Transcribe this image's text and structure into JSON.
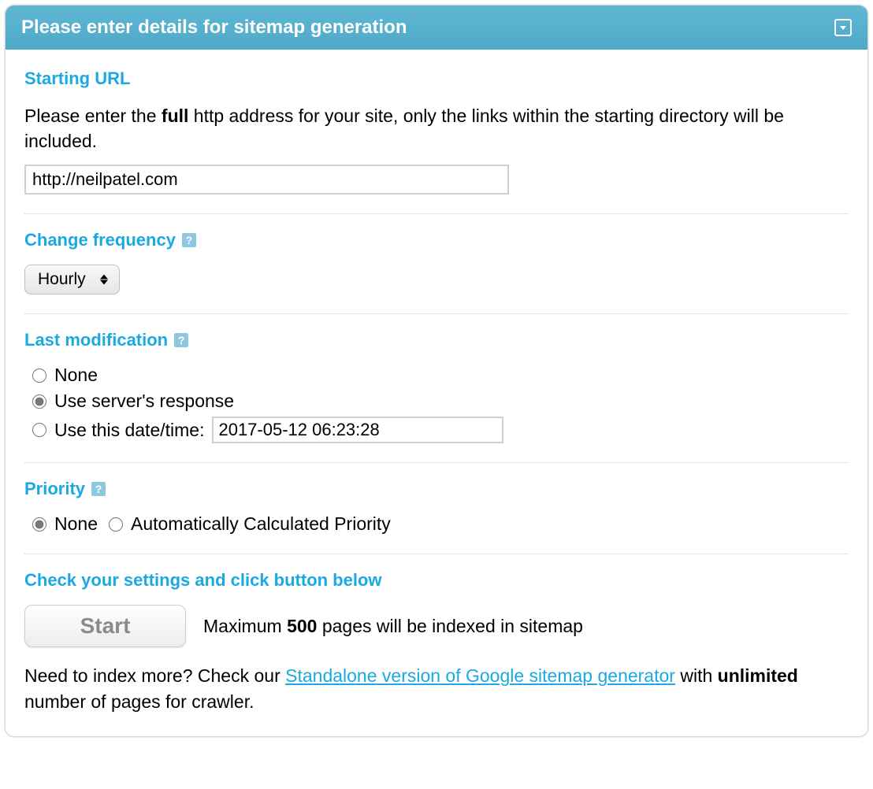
{
  "panel": {
    "title": "Please enter details for sitemap generation"
  },
  "startingUrl": {
    "label": "Starting URL",
    "desc_pre": "Please enter the ",
    "desc_bold": "full",
    "desc_post": " http address for your site, only the links within the starting directory will be included.",
    "value": "http://neilpatel.com"
  },
  "changeFrequency": {
    "label": "Change frequency",
    "selected": "Hourly"
  },
  "lastModification": {
    "label": "Last modification",
    "options": {
      "none": "None",
      "server": "Use server's response",
      "date": "Use this date/time:"
    },
    "dateValue": "2017-05-12 06:23:28"
  },
  "priority": {
    "label": "Priority",
    "options": {
      "none": "None",
      "auto": "Automatically Calculated Priority"
    }
  },
  "submit": {
    "label": "Check your settings and click button below",
    "button": "Start",
    "max_pre": "Maximum ",
    "max_bold": "500",
    "max_post": " pages will be indexed in sitemap"
  },
  "footer": {
    "pre": "Need to index more? Check our ",
    "link": "Standalone version of Google sitemap generator",
    "mid": " with ",
    "bold": "unlimited",
    "post": " number of pages for crawler."
  }
}
